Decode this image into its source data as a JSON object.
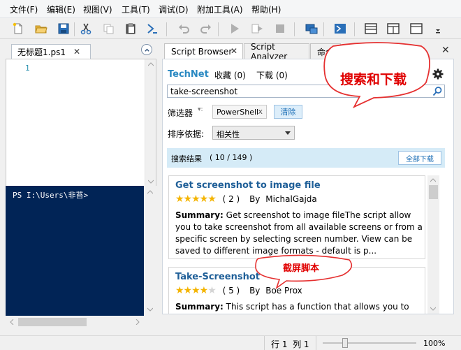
{
  "menu": [
    "文件(F)",
    "编辑(E)",
    "视图(V)",
    "工具(T)",
    "调试(D)",
    "附加工具(A)",
    "帮助(H)"
  ],
  "editor": {
    "tab_label": "无标题1.ps1",
    "close": "✕",
    "line_number": "1"
  },
  "console": {
    "prompt": "PS I:\\Users\\非苔>"
  },
  "right_tabs": [
    "Script Browser",
    "Script Analyzer",
    "命令"
  ],
  "browser": {
    "source": "TechNet",
    "favorites": "收藏 (0)",
    "downloads": "下载 (0)",
    "search_value": "take-screenshot",
    "filter_label": "筛选器",
    "filter_chip": "PowerShell",
    "filter_chip_close": "x",
    "clear_button": "清除",
    "sort_label": "排序依据:",
    "sort_value": "相关性",
    "results_label": "搜索结果",
    "results_count": "( 10 / 149 )",
    "download_all": "全部下载"
  },
  "results": [
    {
      "title": "Get screenshot to image file",
      "rating": 5,
      "rating_count": "( 2 )",
      "by": "By",
      "author": "MichalGajda",
      "summary_label": "Summary:",
      "summary": "Get screenshot to image fileThe script allow you to take screenshot from all available screens or from a specific screen by selecting screen number. View can be saved to different image formats - default is p..."
    },
    {
      "title": "Take-Screenshot",
      "rating": 4,
      "rating_count": "( 5 )",
      "by": "By",
      "author": "Boe Prox",
      "summary_label": "Summary:",
      "summary": "This script has a function that allows you to take a screenshot of the entire desktop or of an active"
    }
  ],
  "annotations": {
    "search_download": "搜索和下载",
    "screenshot_script": "截屏脚本"
  },
  "status": {
    "position": "行 1  列 1",
    "zoom": "100%",
    "zoom_level": 0.1
  }
}
